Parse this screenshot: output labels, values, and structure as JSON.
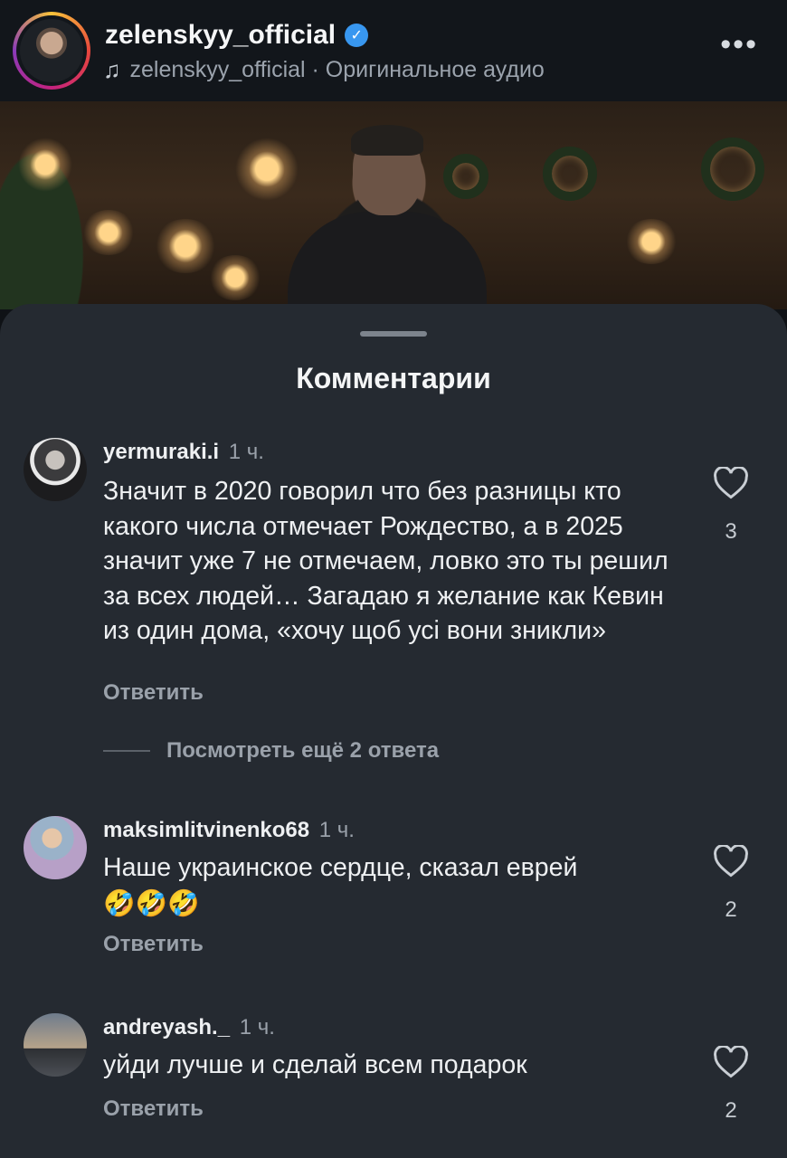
{
  "header": {
    "username": "zelenskyy_official",
    "audio_text": "zelenskyy_official · Оригинальное аудио",
    "more_icon": "more-horizontal-icon",
    "verified_icon": "verified-badge-icon",
    "music_icon": "music-note-icon"
  },
  "sheet": {
    "title": "Комментарии"
  },
  "comments": [
    {
      "username": "yermuraki.i",
      "time": "1 ч.",
      "text": "Значит в 2020 говорил что без разницы кто какого числа отмечает Рождество, а в 2025 значит уже 7 не отмечаем, ловко это ты решил за всех людей… Загадаю я желание как Кевин из один дома, «хочу щоб усі вони зникли»",
      "reply_label": "Ответить",
      "likes": "3",
      "view_replies": "Посмотреть ещё 2 ответа"
    },
    {
      "username": "maksimlitvinenko68",
      "time": "1 ч.",
      "text": "Наше украинское сердце, сказал еврей",
      "emojis": "🤣🤣🤣",
      "reply_label": "Ответить",
      "likes": "2"
    },
    {
      "username": "andreyash._",
      "time": "1 ч.",
      "text": "уйди лучше и сделай всем подарок",
      "reply_label": "Ответить",
      "likes": "2"
    }
  ],
  "colors": {
    "background": "#0f1216",
    "sheet": "#252a31",
    "muted_text": "#9aa1aa",
    "verified": "#3897f0"
  }
}
